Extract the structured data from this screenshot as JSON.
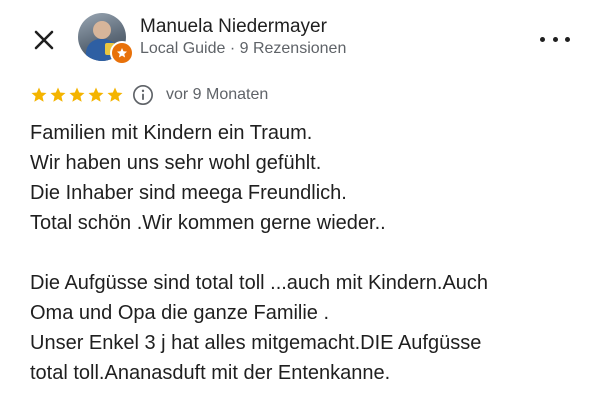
{
  "header": {
    "close_icon": "close-icon",
    "user_name": "Manuela Niedermayer",
    "user_meta": "Local Guide · 9 Rezensionen",
    "badge_icon": "local-guide-star-icon",
    "more_icon": "more-horizontal-icon"
  },
  "review": {
    "rating": 5,
    "rating_max": 5,
    "star_color": "#f4b400",
    "info_icon": "info-icon",
    "date": "vor 9 Monaten",
    "lines": [
      "Familien mit Kindern ein Traum.",
      "Wir haben uns sehr wohl gefühlt.",
      "Die Inhaber sind meega Freundlich.",
      "Total schön .Wir kommen gerne wieder..",
      "",
      "Die Aufgüsse sind total toll ...auch mit Kindern.Auch",
      "Oma und Opa die ganze Familie .",
      "Unser Enkel 3 j hat alles mitgemacht.DIE Aufgüsse",
      "total toll.Ananasduft mit der Entenkanne."
    ]
  },
  "colors": {
    "accent_orange": "#e8710a",
    "secondary_text": "#5f6368",
    "primary_text": "#1f1f1f"
  }
}
